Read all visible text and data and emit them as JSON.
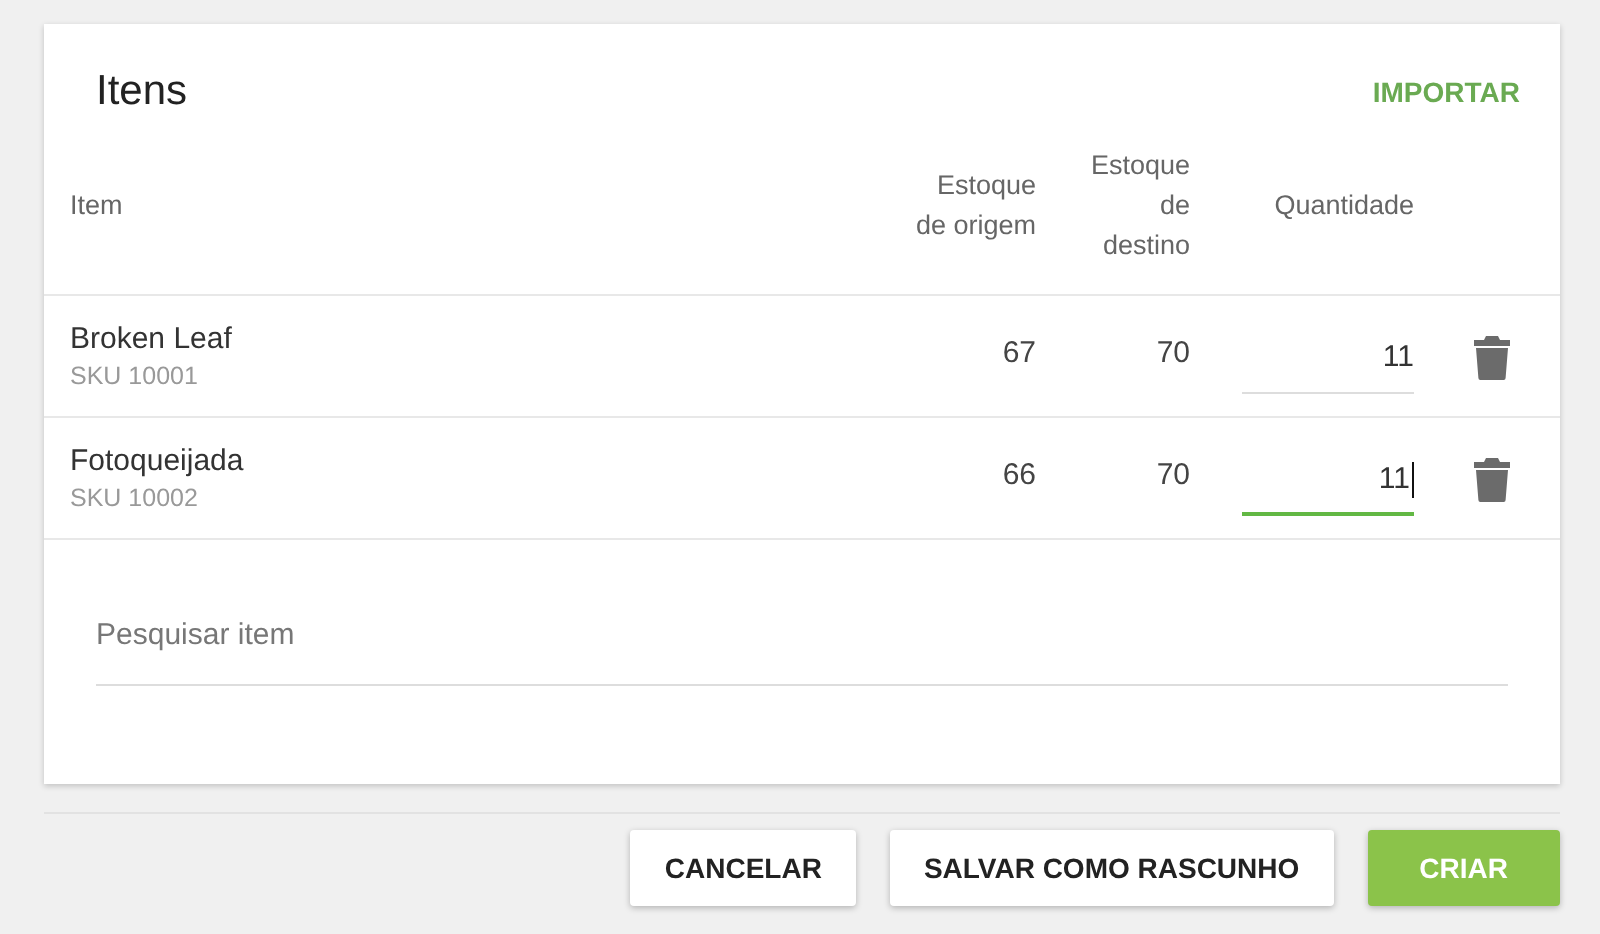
{
  "card": {
    "title": "Itens",
    "import_label": "IMPORTAR"
  },
  "table": {
    "columns": [
      "Item",
      "Estoque de origem",
      "Estoque de destino",
      "Quantidade"
    ],
    "rows": [
      {
        "name": "Broken Leaf",
        "sku": "SKU 10001",
        "origin_stock": "67",
        "destination_stock": "70",
        "quantity": "11",
        "focused": false
      },
      {
        "name": "Fotoqueijada",
        "sku": "SKU 10002",
        "origin_stock": "66",
        "destination_stock": "70",
        "quantity": "11",
        "focused": true
      }
    ]
  },
  "search": {
    "placeholder": "Pesquisar item"
  },
  "buttons": [
    {
      "label": "CANCELAR",
      "kind": "default"
    },
    {
      "label": "SALVAR COMO RASCUNHO",
      "kind": "default"
    },
    {
      "label": "CRIAR",
      "kind": "primary"
    }
  ]
}
